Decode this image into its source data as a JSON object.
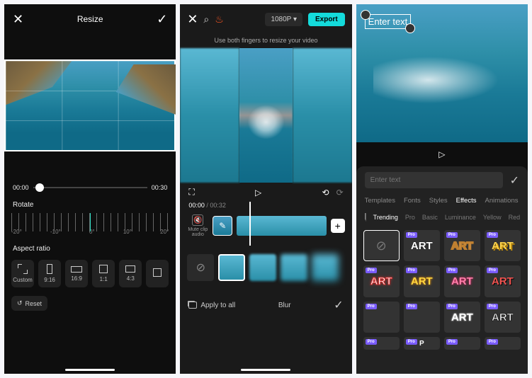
{
  "screen1": {
    "title": "Resize",
    "time_start": "00:00",
    "time_end": "00:30",
    "rotate_label": "Rotate",
    "rotate_ticks": [
      "-20°",
      "-10°",
      "0°",
      "10°",
      "20°"
    ],
    "aspect_label": "Aspect ratio",
    "ratios": [
      {
        "label": "Custom",
        "shape": "expand"
      },
      {
        "label": "9:16",
        "shape": "r916"
      },
      {
        "label": "16:9",
        "shape": "r169"
      },
      {
        "label": "1:1",
        "shape": "r11"
      },
      {
        "label": "4:3",
        "shape": "r43"
      },
      {
        "label": "",
        "shape": "r11"
      }
    ],
    "reset_label": "Reset"
  },
  "screen2": {
    "resolution": "1080P ▾",
    "export_label": "Export",
    "hint": "Use both fingers to resize your video",
    "time_current": "00:00",
    "time_total": "00:32",
    "mute_label": "Mute clip audio",
    "apply_all": "Apply to all",
    "effect_name": "Blur"
  },
  "screen3": {
    "text_overlay": "Enter text",
    "input_placeholder": "Enter text",
    "tabs": [
      "Templates",
      "Fonts",
      "Styles",
      "Effects",
      "Animations"
    ],
    "active_tab": "Effects",
    "subtabs": [
      "Trending",
      "Pro",
      "Basic",
      "Luminance",
      "Yellow",
      "Red"
    ],
    "active_subtab": "Trending",
    "pro_tag": "Pro",
    "art_text": "ART",
    "p_label": "P"
  }
}
